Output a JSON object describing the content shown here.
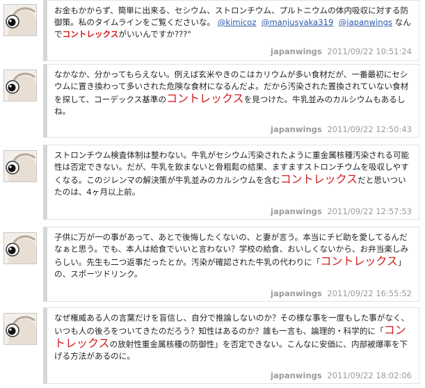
{
  "tweets": [
    {
      "pre": "お金もかからず、簡単に出来る、セシウム、ストロンチウム、プルトニウムの体内吸収に対する防御策。私のタイムラインをご覧くださいな。",
      "links": [
        "@kimicoz",
        "@manjusyaka319",
        "@japanwings"
      ],
      "mid": "なんで",
      "highlight": "コントレックス",
      "post": "がいいんですか???\"",
      "user": "japanwings",
      "time": "2011/09/22 10:51:24"
    },
    {
      "pre": "なかなか、分かってもらえない。例えば玄米やきのこはカリウムが多い食材だが、一番最初にセシウムに置き換わって多いされた危険な食材になるんだよ。だから汚染された置換されていない食材を探して、コーデックス基準の",
      "highlight": "コントレックス",
      "post": "を見つけた。牛乳並みのカルシウムもあるしね。",
      "user": "japanwings",
      "time": "2011/09/22 12:50:43"
    },
    {
      "pre": "ストロンチウム検査体制は整わない。牛乳がセシウム汚染されたように重金属核種汚染される可能性は否定できない。だが、牛乳を飲まないと骨粗鬆の結果、ますますストロンチウムを吸収しやすくなる。このジレンマの解決策が牛乳並みのカルシウムを含む",
      "highlight": "コントレックス",
      "post": "だと思いついたのは、4ヶ月以上前。",
      "user": "japanwings",
      "time": "2011/09/22 12:57:53"
    },
    {
      "pre": "子供に万が一の事があって、あとで後悔したくないの、と妻が言う。本当にチビ助を愛してるんだなぁと思う。でも、本人は給食でいいと言わない？学校の給食、おいしくないから、お弁当楽しみらしい。先生も二つ返事だったとか。汚染が確認された牛乳の代わりに「",
      "highlight": "コントレックス",
      "post": "」の、スポーツドリンク。",
      "user": "japanwings",
      "time": "2011/09/22 16:55:52"
    },
    {
      "pre": "なぜ権威ある人の言葉だけを盲信し、自分で推論しないのか？その様な事を一度もした事がなく、いつも人の後ろをついてきたのだろう？知性はあるのか？誰も一言も、論理的・科学的に「",
      "highlight": "コントレックス",
      "post": "の放射性重金属核種の防御性」を否定できない。こんなに安価に、内部被爆率を下げる方法があるのに。",
      "user": "japanwings",
      "time": "2011/09/22 18:02:06"
    }
  ]
}
